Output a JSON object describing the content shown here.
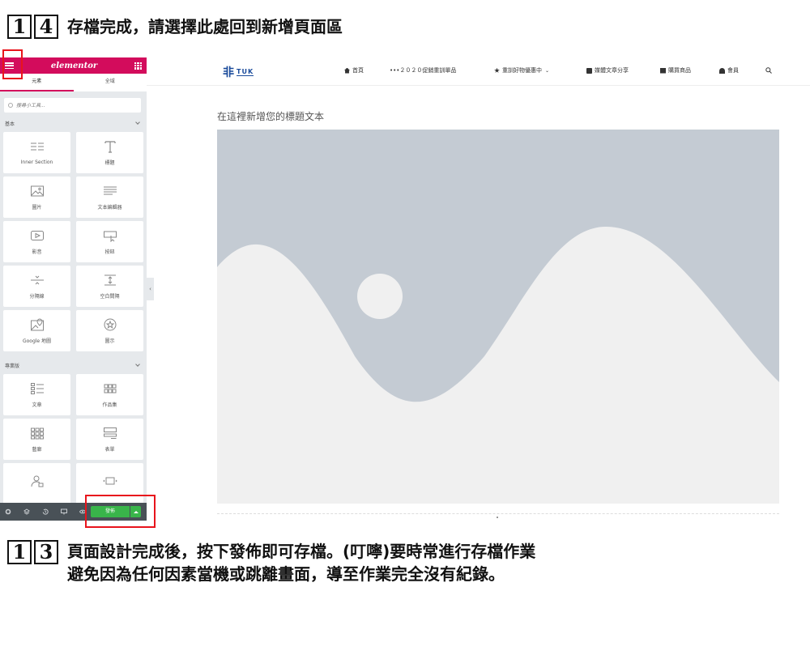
{
  "captions": {
    "top": {
      "digits": [
        "1",
        "4"
      ],
      "text": "存檔完成，請選擇此處回到新增頁面區"
    },
    "bottom": {
      "digits": [
        "1",
        "3"
      ],
      "line1": "頁面設計完成後，按下發佈即可存檔。(叮嚀)要時常進行存檔作業",
      "line2": "避免因為任何因素當機或跳離畫面，導至作業完全沒有紀錄。"
    }
  },
  "panel": {
    "logo": "elementor",
    "tabs": [
      "元素",
      "全域"
    ],
    "search_placeholder": "搜尋小工具...",
    "section_basic": "基本",
    "section_pro": "專業版",
    "widgets_basic": [
      "Inner Section",
      "標題",
      "圖片",
      "文本編輯器",
      "影音",
      "按鈕",
      "分隔線",
      "空白間隔",
      "Google 地圖",
      "圖示"
    ],
    "widgets_pro": [
      "文章",
      "作品集",
      "藝廊",
      "表單"
    ],
    "publish_label": "發佈"
  },
  "site": {
    "logo_mark": "非",
    "logo_text": "TUK",
    "nav": [
      "首頁",
      "•••２０２０促銷重訓單品",
      "重訓好物優惠中",
      "媒體文章分享",
      "購買商品",
      "會員"
    ],
    "page_title": "在這裡新增您的標題文本"
  },
  "colors": {
    "elementor_brand": "#d30c5c",
    "publish_green": "#39b54a",
    "highlight_red": "#e8141c",
    "placeholder_bg": "#c4cbd3",
    "placeholder_fg": "#f0f0f0"
  }
}
